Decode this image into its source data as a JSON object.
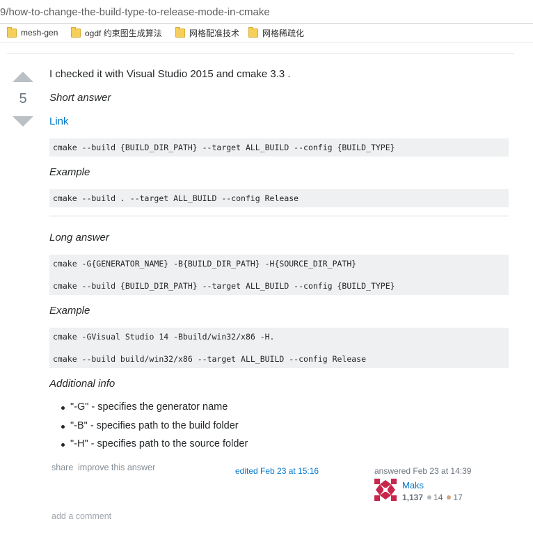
{
  "browser": {
    "url": "9/how-to-change-the-build-type-to-release-mode-in-cmake",
    "bookmarks": [
      "mesh-gen",
      "ogdf 约束图生成算法",
      "网格配准技术",
      "网格稀疏化"
    ]
  },
  "answer": {
    "vote_count": "5",
    "intro": "I checked it with Visual Studio 2015 and cmake 3.3 .",
    "short_heading": "Short answer",
    "link_text": "Link",
    "code1": "cmake --build {BUILD_DIR_PATH} --target ALL_BUILD --config {BUILD_TYPE}",
    "example1_heading": "Example",
    "code2": "cmake --build . --target ALL_BUILD --config Release",
    "long_heading": "Long answer",
    "code3_line1": "cmake -G{GENERATOR_NAME} -B{BUILD_DIR_PATH} -H{SOURCE_DIR_PATH}",
    "code3_line2": "cmake --build {BUILD_DIR_PATH} --target ALL_BUILD --config {BUILD_TYPE}",
    "example2_heading": "Example",
    "code4_line1": "cmake -GVisual Studio 14 -Bbuild/win32/x86 -H.",
    "code4_line2": "cmake --build build/win32/x86 --target ALL_BUILD --config Release",
    "additional_heading": "Additional info",
    "info_items": [
      "\"-G\" - specifies the generator name",
      "\"-B\" - specifies path to the build folder",
      "\"-H\" - specifies path to the source folder"
    ]
  },
  "footer": {
    "share": "share",
    "improve": "improve this answer",
    "edited": "edited Feb 23 at 15:16",
    "answered": "answered Feb 23 at 14:39",
    "user_name": "Maks",
    "reputation": "1,137",
    "silver_badges": "14",
    "bronze_badges": "17",
    "add_comment": "add a comment"
  },
  "colors": {
    "link": "#0077cc",
    "code_bg": "#eff0f1",
    "vote_arrow": "#bbc0c4",
    "silver": "#b4b8bc",
    "bronze": "#d1a684",
    "avatar": "#c8264a"
  }
}
